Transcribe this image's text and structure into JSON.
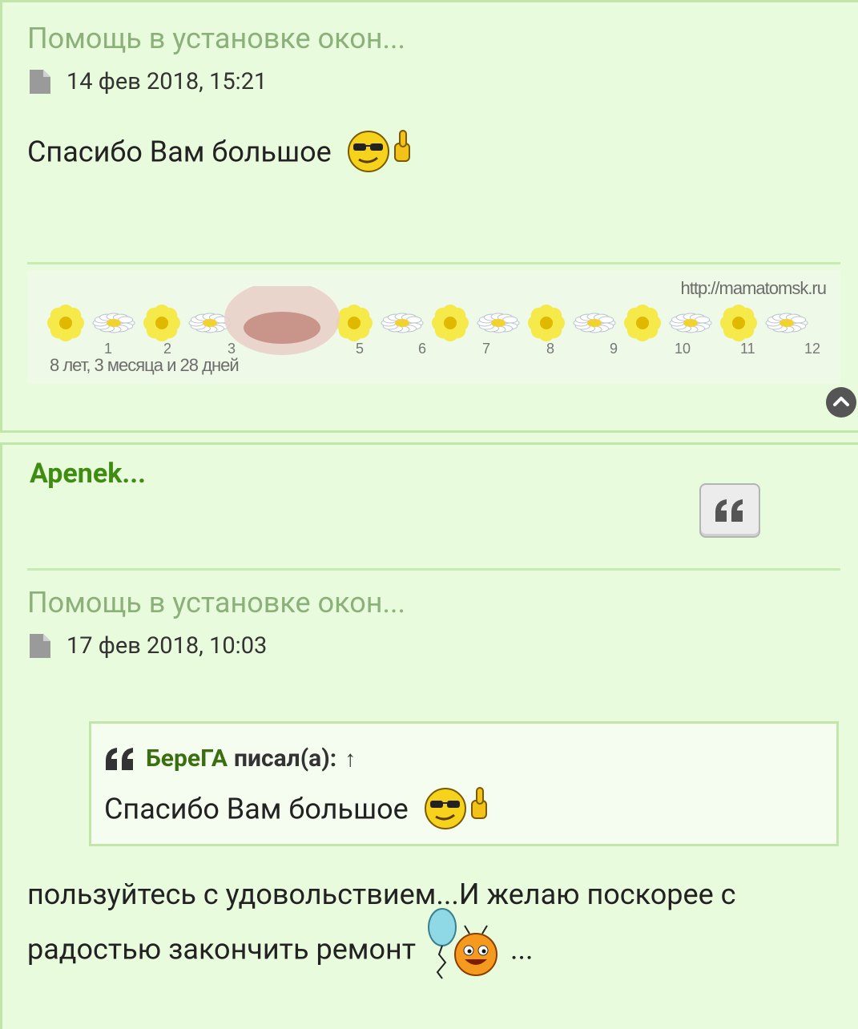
{
  "post1": {
    "topic_title": "Помощь в установке окон...",
    "date": "14 фев 2018, 15:21",
    "body_text": "Спасибо Вам большое",
    "signature": {
      "url": "http://mamatomsk.ru",
      "age": "8 лет, 3 месяца и 28 дней",
      "months": [
        "1",
        "2",
        "3",
        "5",
        "6",
        "7",
        "8",
        "9",
        "10",
        "11",
        "12"
      ]
    }
  },
  "post2": {
    "author": "Apenek...",
    "topic_title": "Помощь в установке окон...",
    "date": "17 фев 2018, 10:03",
    "quote": {
      "author": "БереГА",
      "wrote": "писал(а):",
      "arrow": "↑",
      "text": "Спасибо Вам большое"
    },
    "body_line1": "пользуйтесь с удовольствием...И желаю поскорее с",
    "body_line2": "радостью закончить ремонт",
    "body_tail": "..."
  },
  "colors": {
    "background": "#e9fbdd",
    "border": "#c2e6a9",
    "title": "#8cb07a",
    "author": "#3e8d12"
  },
  "icons": [
    "document-icon",
    "cool-thumbs-up-smiley",
    "chevron-up-icon",
    "quote-icon",
    "balloon-smiley"
  ]
}
